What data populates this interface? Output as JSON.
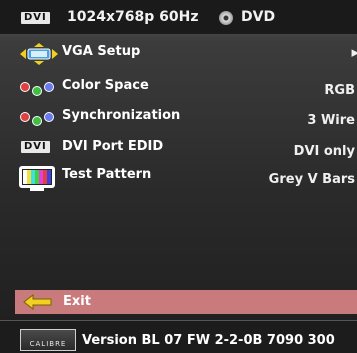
{
  "header": {
    "badge": "DVI",
    "resolution": "1024x768p 60Hz",
    "source": "DVD"
  },
  "menu": [
    {
      "label": "VGA Setup",
      "value": "▸",
      "icon": "vga-icon"
    },
    {
      "label": "Color Space",
      "value": "RGB",
      "icon": "color-dots-icon"
    },
    {
      "label": "Synchronization",
      "value": "3 Wire",
      "icon": "color-dots-icon"
    },
    {
      "label": "DVI Port EDID",
      "value": "DVI only",
      "icon": "dvi-badge-icon",
      "badge": "DVI"
    },
    {
      "label": "Test Pattern",
      "value": "Grey V Bars",
      "icon": "test-pattern-icon"
    }
  ],
  "exit": {
    "label": "Exit",
    "color": "#c87a7c"
  },
  "footer": {
    "logo": "CALIBRE",
    "version": "Version BL 07 FW 2-2-0B 7090 300"
  }
}
